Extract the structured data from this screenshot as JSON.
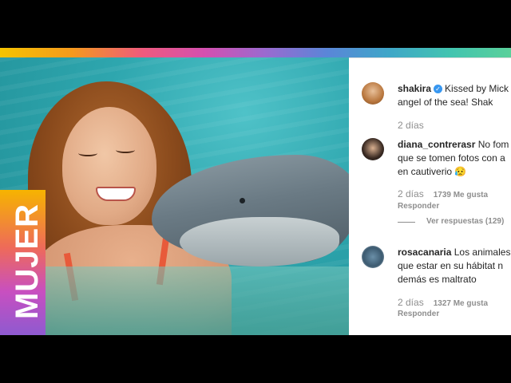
{
  "brand": {
    "label": "MUJER"
  },
  "post": {
    "author": "shakira",
    "verified": true,
    "caption_line1": "Kissed by Mick",
    "caption_line2": "angel of the sea! Shak",
    "time": "2 días"
  },
  "comments": [
    {
      "user": "diana_contrerasr",
      "line1": "No fom",
      "line2": "que se tomen fotos con a",
      "line3": "en cautiverio 😥",
      "time": "2 días",
      "likes": "1739 Me gusta",
      "reply": "Responder",
      "view_replies": "Ver respuestas (129)"
    },
    {
      "user": "rosacanaria",
      "line1": "Los animales",
      "line2": "que estar en su hábitat n",
      "line3": "demás es maltrato",
      "time": "2 días",
      "likes": "1327 Me gusta",
      "reply": "Responder"
    }
  ],
  "colors": {
    "accent_blue": "#3897f0",
    "muted": "#8e8e8e",
    "text": "#262626"
  }
}
